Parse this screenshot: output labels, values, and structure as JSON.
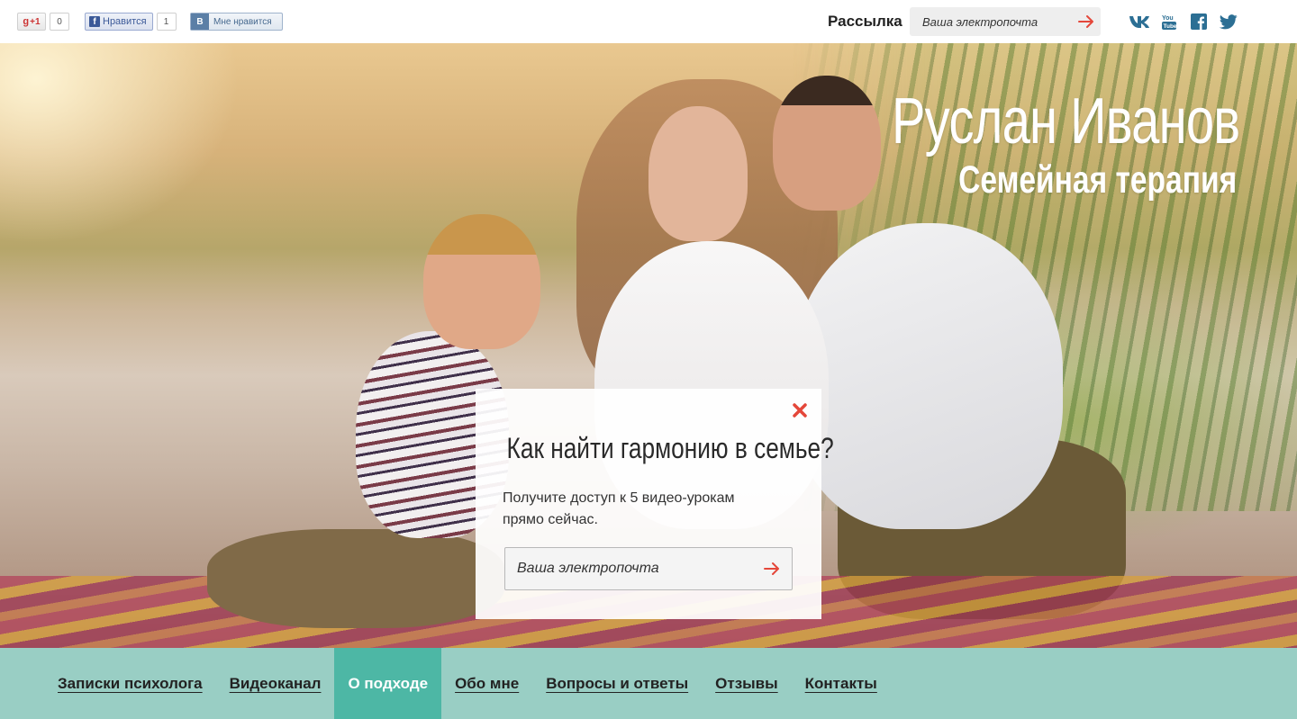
{
  "topbar": {
    "gplus": {
      "label": "+1",
      "count": "0"
    },
    "facebook": {
      "label": "Нравится",
      "count": "1"
    },
    "vk": {
      "badge": "В",
      "label": "Мне нравится"
    },
    "newsletter_label": "Рассылка",
    "email_placeholder": "Ваша электропочта",
    "socials": [
      "vk-icon",
      "youtube-icon",
      "facebook-icon",
      "twitter-icon"
    ]
  },
  "hero": {
    "title": "Руслан Иванов",
    "subtitle": "Семейная терапия"
  },
  "popup": {
    "title": "Как найти гармонию в семье?",
    "text": "Получите доступ к 5 видео-урокам прямо сейчас.",
    "email_placeholder": "Ваша электропочта",
    "close_icon": "close-icon",
    "submit_icon": "arrow-right-icon"
  },
  "nav": {
    "items": [
      {
        "label": "Записки психолога",
        "active": false
      },
      {
        "label": "Видеоканал",
        "active": false
      },
      {
        "label": "О подходе",
        "active": true
      },
      {
        "label": "Обо мне",
        "active": false
      },
      {
        "label": "Вопросы и ответы",
        "active": false
      },
      {
        "label": "Отзывы",
        "active": false
      },
      {
        "label": "Контакты",
        "active": false
      }
    ]
  },
  "colors": {
    "accent": "#e4473a",
    "nav_bg": "#99cec4",
    "nav_active": "#4db7a5",
    "social_icons": "#2c6f94"
  }
}
